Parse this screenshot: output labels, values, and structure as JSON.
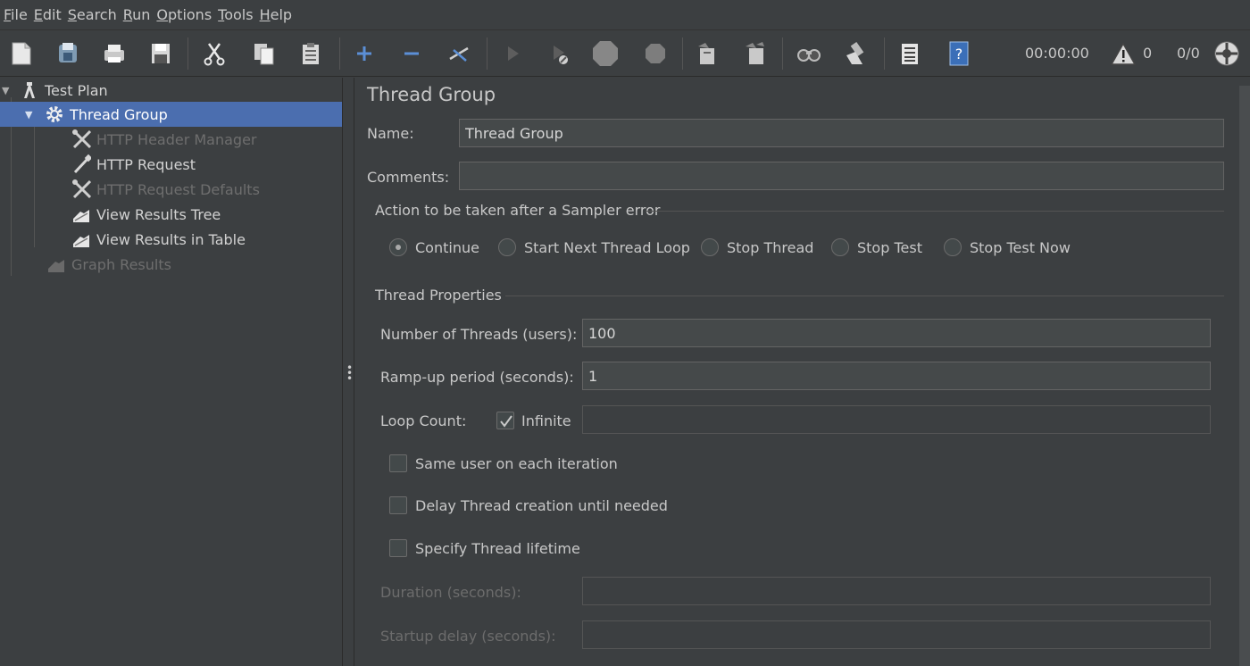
{
  "menu": [
    {
      "key": "F",
      "rest": "ile"
    },
    {
      "key": "E",
      "rest": "dit"
    },
    {
      "key": "S",
      "rest": "earch"
    },
    {
      "key": "R",
      "rest": "un"
    },
    {
      "key": "O",
      "rest": "ptions"
    },
    {
      "key": "T",
      "rest": "ools"
    },
    {
      "key": "H",
      "rest": "elp"
    }
  ],
  "toolbar": {
    "icons": [
      "new-icon",
      "templates-icon",
      "open-icon",
      "save-icon",
      "cut-icon",
      "copy-icon",
      "paste-icon",
      "expand-icon",
      "collapse-icon",
      "toggle-icon",
      "start-icon",
      "start-no-pauses-icon",
      "stop-icon",
      "shutdown-icon",
      "clear-icon",
      "clear-all-icon",
      "search-icon",
      "reset-search-icon",
      "function-helper-icon",
      "help-icon",
      "remote-icon"
    ],
    "timer": "00:00:00",
    "warnings": "0",
    "threads": "0/0"
  },
  "tree": {
    "items": [
      {
        "label": "Test Plan",
        "icon": "test-plan-icon"
      },
      {
        "label": "Thread Group",
        "icon": "gear-icon"
      },
      {
        "label": "HTTP Header Manager",
        "icon": "config-tool-icon"
      },
      {
        "label": "HTTP Request",
        "icon": "pipette-icon"
      },
      {
        "label": "HTTP Request Defaults",
        "icon": "config-tool-icon"
      },
      {
        "label": "View Results Tree",
        "icon": "listener-icon"
      },
      {
        "label": "View Results in Table",
        "icon": "listener-icon"
      },
      {
        "label": "Graph Results",
        "icon": "listener-icon"
      }
    ]
  },
  "panel": {
    "title": "Thread Group",
    "name_label": "Name:",
    "name_value": "Thread Group",
    "comments_label": "Comments:",
    "comments_value": "",
    "sampler_error": {
      "title": "Action to be taken after a Sampler error",
      "options": [
        "Continue",
        "Start Next Thread Loop",
        "Stop Thread",
        "Stop Test",
        "Stop Test Now"
      ],
      "selected": "Continue"
    },
    "thread_props": {
      "title": "Thread Properties",
      "threads_label": "Number of Threads (users):",
      "threads_value": "100",
      "rampup_label": "Ramp-up period (seconds):",
      "rampup_value": "1",
      "loop_label": "Loop Count:",
      "infinite_label": "Infinite",
      "infinite_checked": true,
      "loop_value": "",
      "same_user_label": "Same user on each iteration",
      "delay_label": "Delay Thread creation until needed",
      "lifetime_label": "Specify Thread lifetime",
      "duration_label": "Duration (seconds):",
      "duration_value": "",
      "startup_label": "Startup delay (seconds):",
      "startup_value": ""
    }
  }
}
